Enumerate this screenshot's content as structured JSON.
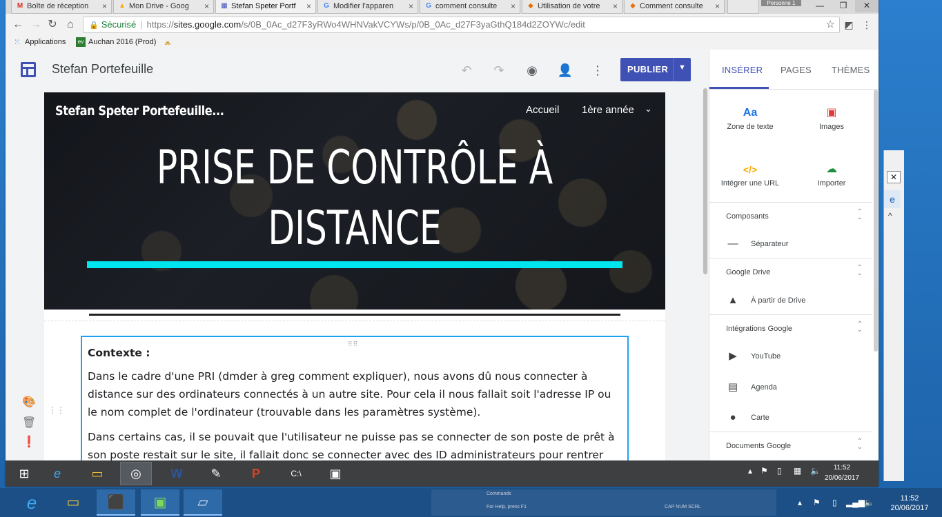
{
  "browser": {
    "tabs": [
      {
        "label": "Boîte de réception",
        "icon": "gmail-icon",
        "active": false
      },
      {
        "label": "Mon Drive - Goog",
        "icon": "drive-icon",
        "active": false
      },
      {
        "label": "Stefan Speter Portf",
        "icon": "sites-icon",
        "active": true
      },
      {
        "label": "Modifier l'apparen",
        "icon": "google-icon",
        "active": false
      },
      {
        "label": "comment consulte",
        "icon": "google-icon",
        "active": false
      },
      {
        "label": "Utilisation de votre",
        "icon": "cube-icon",
        "active": false
      },
      {
        "label": "Comment consulte",
        "icon": "cube-icon",
        "active": false
      }
    ],
    "user_badge": "Personne 1",
    "address": {
      "secure_label": "Sécurisé",
      "url_scheme": "https://",
      "url_host": "sites.google.com",
      "url_path": "/s/0B_0Ac_d27F3yRWo4WHNVakVCYWs/p/0B_0Ac_d27F3yaGthQ184d2ZOYWc/edit"
    },
    "bookmarks": [
      {
        "label": "Applications",
        "icon": "apps-grid-icon"
      },
      {
        "label": "Auchan 2016 (Prod)",
        "icon": "ev-icon"
      },
      {
        "label": "",
        "icon": "bookmark-logo-icon"
      }
    ]
  },
  "editor": {
    "site_name": "Stefan Portefeuille",
    "publish_label": "PUBLIER",
    "panel_tabs": [
      "INSÉRER",
      "PAGES",
      "THÈMES"
    ],
    "insert_items": [
      {
        "label": "Zone de texte",
        "icon_text": "Aa",
        "icon": "text-box-icon",
        "color": "#1a73e8"
      },
      {
        "label": "Images",
        "icon_text": "▣",
        "icon": "image-icon",
        "color": "#e53935"
      },
      {
        "label": "Intégrer une URL",
        "icon_text": "</>",
        "icon": "embed-icon",
        "color": "#f9ab00"
      },
      {
        "label": "Importer",
        "icon_text": "☁",
        "icon": "upload-cloud-icon",
        "color": "#1e8e3e"
      }
    ],
    "sections": [
      {
        "title": "Composants",
        "items": [
          {
            "label": "Séparateur",
            "icon": "divider-icon"
          }
        ]
      },
      {
        "title": "Google Drive",
        "items": [
          {
            "label": "À partir de Drive",
            "icon": "drive-icon"
          }
        ]
      },
      {
        "title": "Intégrations Google",
        "items": [
          {
            "label": "YouTube",
            "icon": "youtube-icon"
          },
          {
            "label": "Agenda",
            "icon": "calendar-icon"
          },
          {
            "label": "Carte",
            "icon": "map-pin-icon"
          }
        ]
      },
      {
        "title": "Documents Google",
        "items": []
      }
    ]
  },
  "page": {
    "site_title": "Stefan Speter Portefeuille...",
    "nav": [
      "Accueil",
      "1ère année"
    ],
    "hero_title_line1": "PRISE DE CONTRÔLE À",
    "hero_title_line2": "DISTANCE",
    "accent_color": "#00e5ee",
    "heading": "Contexte :",
    "paragraph1": "Dans le cadre d'une PRI (dmder à greg comment expliquer), nous avons dû nous connecter à distance sur des ordinateurs connectés à un autre site. Pour cela il nous fallait soit l'adresse IP ou le nom complet de l'ordinateur (trouvable dans les paramètres système).",
    "paragraph2": "Dans certains cas, il se pouvait que l'utilisateur ne puisse pas se connecter de son poste de prêt à son poste restait sur le site, il fallait donc se connecter avec des ID administrateurs pour rentrer"
  },
  "taskbar_inner": {
    "time": "11:52",
    "date": "20/06/2017"
  },
  "taskbar_outer": {
    "time": "11:52",
    "date": "20/06/2017",
    "ghost_text_1": "Commands",
    "ghost_text_2": "For Help, press F1",
    "ghost_text_3": "CAP  NUM  SCRL"
  }
}
